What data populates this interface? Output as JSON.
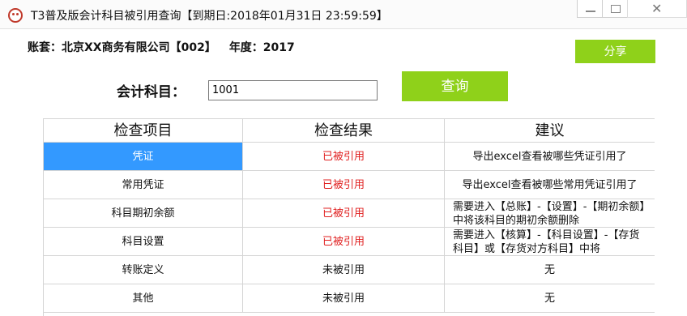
{
  "window": {
    "title": "T3普及版会计科目被引用查询【到期日:2018年01月31日 23:59:59】",
    "close_glyph": "✕"
  },
  "account": {
    "label": "账套：北京XX商务有限公司【002】",
    "year_label": "年度：2017"
  },
  "share_button": "分享",
  "subject": {
    "label": "会计科目：",
    "value": "1001"
  },
  "query_button": "查询",
  "table": {
    "headers": [
      "检查项目",
      "检查结果",
      "建议"
    ],
    "rows": [
      {
        "item": "凭证",
        "result": "已被引用",
        "advice": "导出excel查看被哪些凭证引用了"
      },
      {
        "item": "常用凭证",
        "result": "已被引用",
        "advice": "导出excel查看被哪些常用凭证引用了"
      },
      {
        "item": "科目期初余额",
        "result": "已被引用",
        "advice": "需要进入【总账】-【设置】-【期初余额】中将该科目的期初余额删除"
      },
      {
        "item": "科目设置",
        "result": "已被引用",
        "advice": "需要进入【核算】-【科目设置】-【存货科目】或【存货对方科目】中将"
      },
      {
        "item": "转账定义",
        "result": "未被引用",
        "advice": "无"
      },
      {
        "item": "其他",
        "result": "未被引用",
        "advice": "无"
      }
    ]
  },
  "colors": {
    "accent_green": "#8fd11a",
    "selection_blue": "#3399ff",
    "referenced_red": "#e02020"
  }
}
